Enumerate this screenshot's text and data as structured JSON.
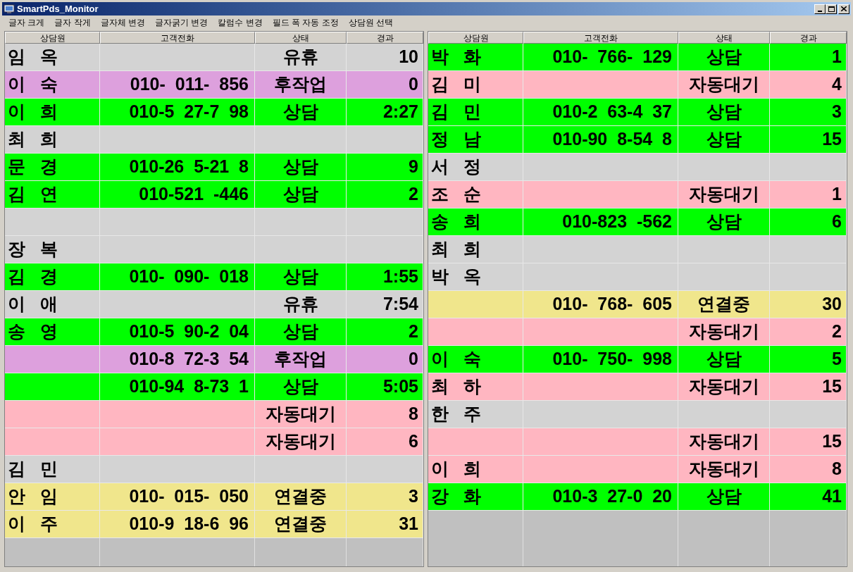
{
  "window": {
    "title": "SmartPds_Monitor"
  },
  "menu": [
    "글자 크게",
    "글자 작게",
    "글자체 변경",
    "글자굵기 변경",
    "칼럼수 변경",
    "필드 폭 자동 조정",
    "상담원 선택"
  ],
  "panels": [
    {
      "columns": [
        "상담원",
        "고객전화",
        "상태",
        "경과"
      ],
      "rows": [
        {
          "agent": "임   옥",
          "status": "유휴",
          "elapsed": "10",
          "color": "#d3d3d3"
        },
        {
          "agent": "이   숙",
          "phone": "010-  011-  856",
          "status": "후작업",
          "elapsed": "0",
          "color": "#dda0dd"
        },
        {
          "agent": "이   희",
          "phone": "010-5  27-7  98",
          "status": "상담",
          "elapsed": "2:27",
          "color": "#00ff00"
        },
        {
          "agent": "최   희",
          "color": "#d3d3d3"
        },
        {
          "agent": "문   경",
          "phone": "010-26  5-21  8",
          "status": "상담",
          "elapsed": "9",
          "color": "#00ff00"
        },
        {
          "agent": "김   연",
          "phone": "010-521  -446",
          "status": "상담",
          "elapsed": "2",
          "color": "#00ff00"
        },
        {
          "color": "#d3d3d3"
        },
        {
          "agent": "장   복",
          "color": "#d3d3d3"
        },
        {
          "agent": "김   경",
          "phone": "010-  090-  018",
          "status": "상담",
          "elapsed": "1:55",
          "color": "#00ff00"
        },
        {
          "agent": "이   애",
          "status": "유휴",
          "elapsed": "7:54",
          "color": "#d3d3d3"
        },
        {
          "agent": "송   영",
          "phone": "010-5  90-2  04",
          "status": "상담",
          "elapsed": "2",
          "color": "#00ff00"
        },
        {
          "phone": "010-8  72-3  54",
          "status": "후작업",
          "elapsed": "0",
          "color": "#dda0dd"
        },
        {
          "phone": "010-94  8-73  1",
          "status": "상담",
          "elapsed": "5:05",
          "color": "#00ff00"
        },
        {
          "status": "자동대기",
          "elapsed": "8",
          "color": "#ffb6c1"
        },
        {
          "status": "자동대기",
          "elapsed": "6",
          "color": "#ffb6c1"
        },
        {
          "agent": "김   민",
          "color": "#d3d3d3"
        },
        {
          "agent": "안   임",
          "phone": "010-  015-  050",
          "status": "연결중",
          "elapsed": "3",
          "color": "#f0e68c"
        },
        {
          "agent": "이   주",
          "phone": "010-9  18-6  96",
          "status": "연결중",
          "elapsed": "31",
          "color": "#f0e68c"
        }
      ]
    },
    {
      "columns": [
        "상담원",
        "고객전화",
        "상태",
        "경과"
      ],
      "rows": [
        {
          "agent": "박   화",
          "phone": "010-  766-  129",
          "status": "상담",
          "elapsed": "1",
          "color": "#00ff00"
        },
        {
          "agent": "김   미",
          "status": "자동대기",
          "elapsed": "4",
          "color": "#ffb6c1"
        },
        {
          "agent": "김   민",
          "phone": "010-2  63-4  37",
          "status": "상담",
          "elapsed": "3",
          "color": "#00ff00"
        },
        {
          "agent": "정   남",
          "phone": "010-90  8-54  8",
          "status": "상담",
          "elapsed": "15",
          "color": "#00ff00"
        },
        {
          "agent": "서   정",
          "color": "#d3d3d3"
        },
        {
          "agent": "조   순",
          "status": "자동대기",
          "elapsed": "1",
          "color": "#ffb6c1"
        },
        {
          "agent": "송   희",
          "phone": "010-823  -562",
          "status": "상담",
          "elapsed": "6",
          "color": "#00ff00"
        },
        {
          "agent": "최   희",
          "color": "#d3d3d3"
        },
        {
          "agent": "박   옥",
          "color": "#d3d3d3"
        },
        {
          "phone": "010-  768-  605",
          "status": "연결중",
          "elapsed": "30",
          "color": "#f0e68c"
        },
        {
          "status": "자동대기",
          "elapsed": "2",
          "color": "#ffb6c1"
        },
        {
          "agent": "이   숙",
          "phone": "010-  750-  998",
          "status": "상담",
          "elapsed": "5",
          "color": "#00ff00"
        },
        {
          "agent": "최   하",
          "status": "자동대기",
          "elapsed": "15",
          "color": "#ffb6c1"
        },
        {
          "agent": "한   주",
          "color": "#d3d3d3"
        },
        {
          "status": "자동대기",
          "elapsed": "15",
          "color": "#ffb6c1"
        },
        {
          "agent": "이   희",
          "status": "자동대기",
          "elapsed": "8",
          "color": "#ffb6c1"
        },
        {
          "agent": "강   화",
          "phone": "010-3  27-0  20",
          "status": "상담",
          "elapsed": "41",
          "color": "#00ff00"
        }
      ]
    }
  ]
}
